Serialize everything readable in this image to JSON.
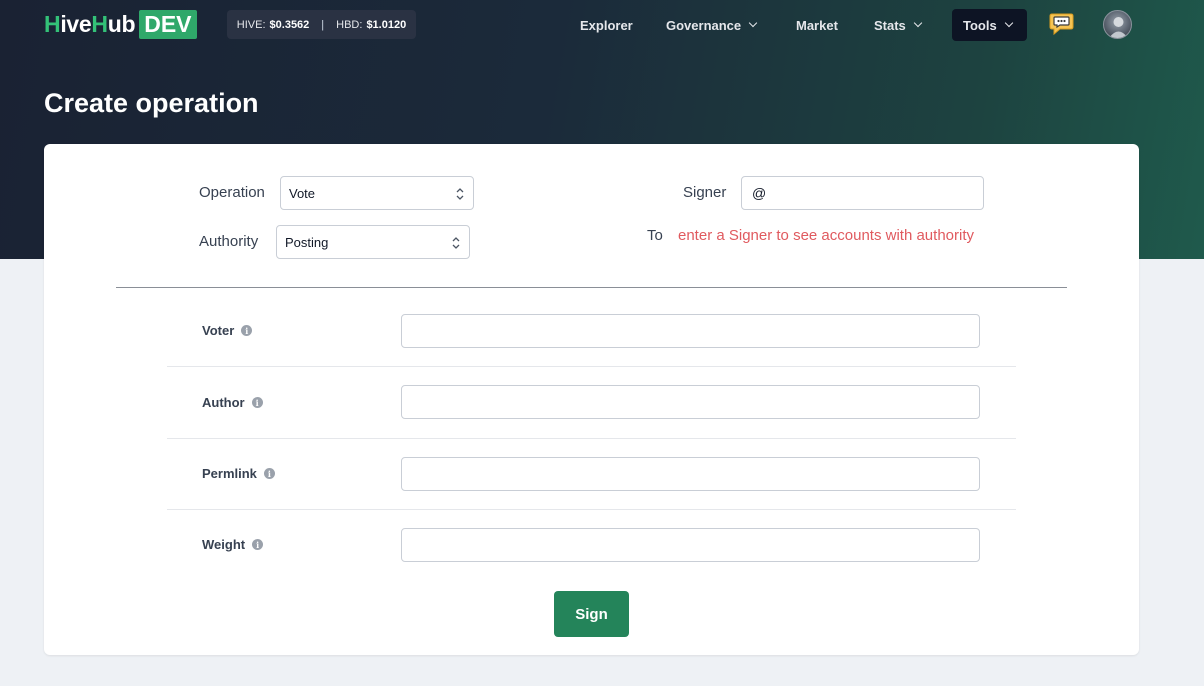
{
  "brand": {
    "logo_hive": "H",
    "logo_ive": "ive",
    "logo_h2": "H",
    "logo_ub": "ub",
    "logo_badge": "DEV"
  },
  "prices": {
    "hive_label": "HIVE:",
    "hive_value": "$0.3562",
    "separator": "|",
    "hbd_label": "HBD:",
    "hbd_value": "$1.0120"
  },
  "nav": {
    "items": [
      {
        "label": "Explorer"
      },
      {
        "label": "Governance"
      },
      {
        "label": "Market"
      },
      {
        "label": "Stats"
      },
      {
        "label": "Tools"
      }
    ]
  },
  "page": {
    "title": "Create operation"
  },
  "form": {
    "operation_label": "Operation",
    "operation_value": "Vote",
    "authority_label": "Authority",
    "authority_value": "Posting",
    "signer_label": "Signer",
    "signer_value": "@",
    "to_label": "To",
    "to_hint": "enter a Signer to see accounts with authority",
    "fields": [
      {
        "label": "Voter",
        "value": ""
      },
      {
        "label": "Author",
        "value": ""
      },
      {
        "label": "Permlink",
        "value": ""
      },
      {
        "label": "Weight",
        "value": ""
      }
    ],
    "sign_label": "Sign"
  },
  "icons": {
    "chat": "chat-bubble-icon",
    "avatar": "user-avatar",
    "info": "info-icon",
    "chevron": "chevron-down-icon",
    "select": "up-down-chevron-icon"
  },
  "colors": {
    "brand_green": "#33c178",
    "badge_green": "#2fa86a",
    "button_green": "#24845a",
    "hint_red": "#e05a5f",
    "header_dark": "#1a2233"
  }
}
